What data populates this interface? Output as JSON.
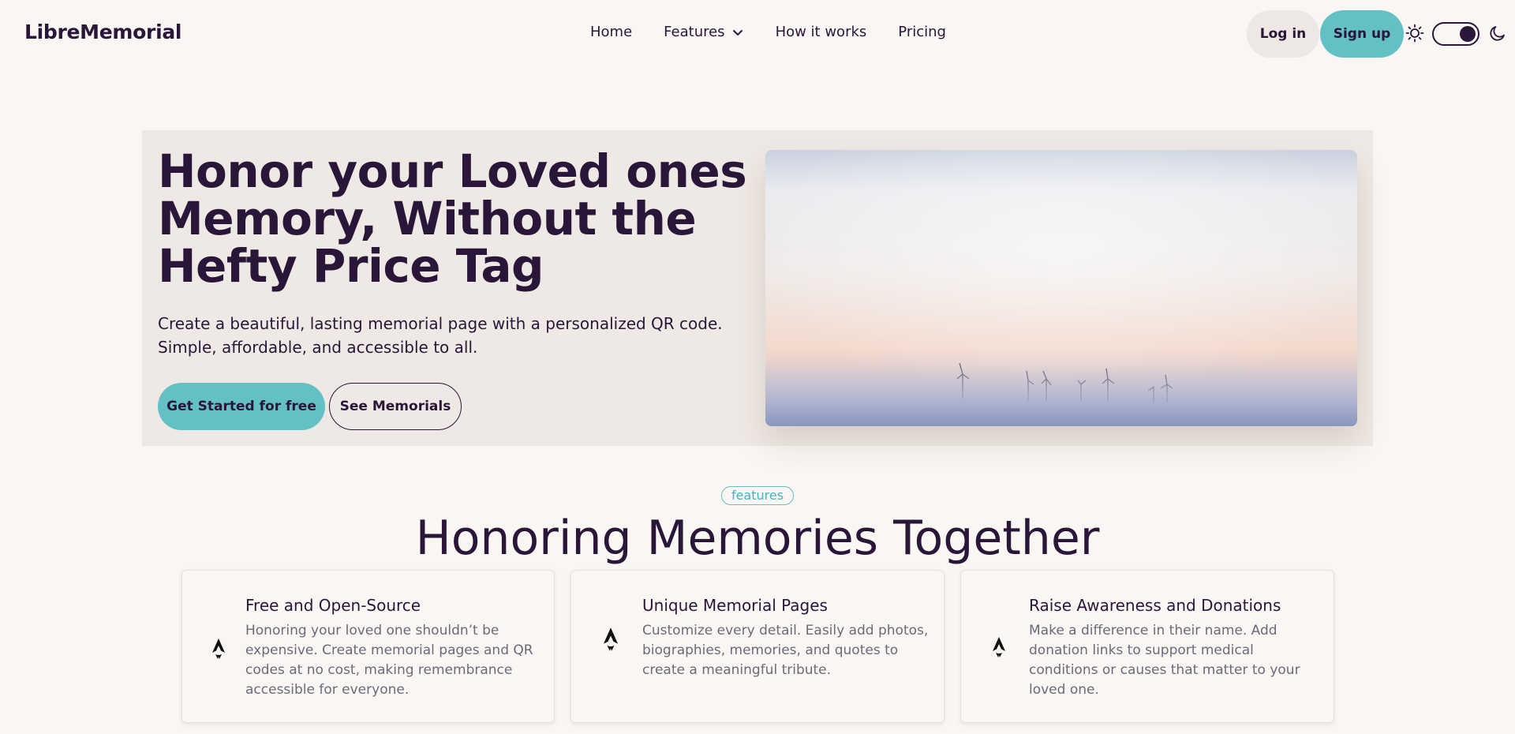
{
  "header": {
    "logo": "LibreMemorial",
    "nav": [
      {
        "label": "Home"
      },
      {
        "label": "Features"
      },
      {
        "label": "How it works"
      },
      {
        "label": "Pricing"
      }
    ],
    "login_label": "Log in",
    "signup_label": "Sign up"
  },
  "hero": {
    "title": "Honor your Loved ones Memory, Without the Hefty Price Tag",
    "subtitle": "Create a beautiful, lasting memorial page with a personalized QR code. Simple, affordable, and accessible to all.",
    "primary_cta": "Get Started for free",
    "secondary_cta": "See Memorials"
  },
  "features": {
    "tag": "features",
    "title": "Honoring Memories Together",
    "cards": [
      {
        "title": "Free and Open-Source",
        "description": "Honoring your loved one shouldn’t be expensive. Create memorial pages and QR codes at no cost, making remembrance accessible for everyone.",
        "icon": "astro-logo-icon"
      },
      {
        "title": "Unique Memorial Pages",
        "description": "Customize every detail. Easily add photos, biographies, memories, and quotes to create a meaningful tribute.",
        "icon": "astro-logo-icon"
      },
      {
        "title": "Raise Awareness and Donations",
        "description": "Make a difference in their name. Add donation links to support medical conditions or causes that matter to your loved one.",
        "icon": "astro-logo-icon"
      }
    ]
  },
  "colors": {
    "background": "#f9f6f3",
    "primary_text": "#2a1638",
    "accent": "#63c1c6",
    "hero_bg": "#efe9e5"
  }
}
